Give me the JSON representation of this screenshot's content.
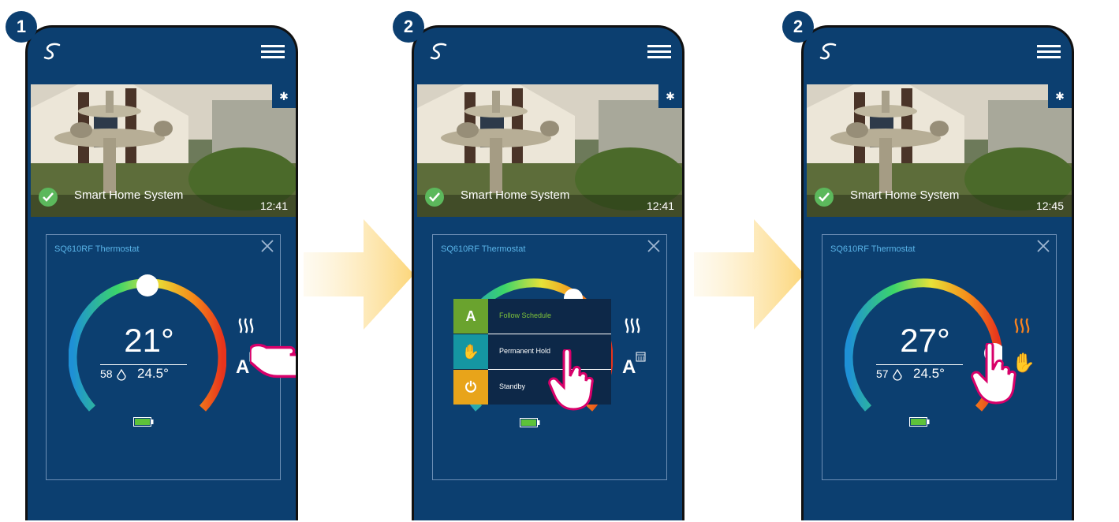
{
  "screens": [
    {
      "step": "1",
      "system_name": "Smart Home System",
      "time": "12:41",
      "device_title": "SQ610RF Thermostat",
      "set_temp": "21°",
      "humidity": "58",
      "current_temp": "24.5°",
      "mode_icon": "schedule-mode-icon",
      "heating_active": false
    },
    {
      "step": "2",
      "system_name": "Smart Home System",
      "time": "12:41",
      "device_title": "SQ610RF Thermostat",
      "set_temp": "",
      "humidity": "",
      "current_temp": "",
      "mode_icon": "schedule-mode-icon",
      "heating_active": false,
      "mode_menu": [
        {
          "label": "Follow Schedule",
          "icon": "schedule-mode-icon",
          "color": "#6aa32e",
          "text_color": "#7fc43a"
        },
        {
          "label": "Permanent Hold",
          "icon": "hand-icon",
          "color": "#1596a2",
          "text_color": "#ffffff"
        },
        {
          "label": "Standby",
          "icon": "power-icon",
          "color": "#e8a41a",
          "text_color": "#ffffff"
        }
      ]
    },
    {
      "step": "2",
      "system_name": "Smart Home System",
      "time": "12:45",
      "device_title": "SQ610RF Thermostat",
      "set_temp": "27°",
      "humidity": "57",
      "current_temp": "24.5°",
      "mode_icon": "hand-icon",
      "heating_active": true
    }
  ],
  "colors": {
    "panel": "#0c3f70",
    "heat_active": "#f58220",
    "heat_idle": "#ffffff",
    "arrow": "#fcd67a"
  }
}
